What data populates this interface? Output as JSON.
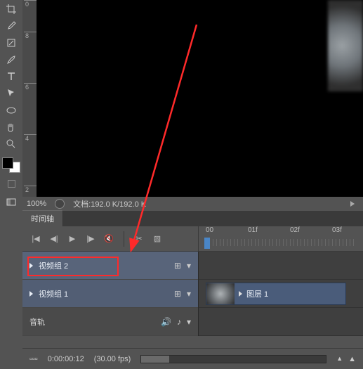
{
  "ruler": {
    "t0": "0",
    "t1": "8",
    "t2": "6",
    "t3": "4",
    "t4": "2"
  },
  "status": {
    "zoom": "100%",
    "doc_info": "文档:192.0 K/192.0 K"
  },
  "panel": {
    "timeline_tab": "时间轴"
  },
  "time_ruler": {
    "t0": "00",
    "t1": "01f",
    "t2": "02f",
    "t3": "03f"
  },
  "tracks": {
    "video_group_2": "视频组 2",
    "video_group_1": "视频组 1",
    "audio": "音轨"
  },
  "clip": {
    "layer": "图层 1"
  },
  "footer": {
    "zoom_small": "▫▫▫",
    "timecode": "0:00:00:12",
    "fps": "(30.00 fps)"
  },
  "icons": {
    "film": "⊞",
    "speaker": "🔊",
    "note": "♪",
    "chev": "▾",
    "mount": "▲",
    "prev": "|◀",
    "back": "◀|",
    "play": "▶",
    "fwd": "|▶",
    "next": "▶|",
    "mute": "🔇",
    "scissors": "✂",
    "transition": "▧"
  }
}
